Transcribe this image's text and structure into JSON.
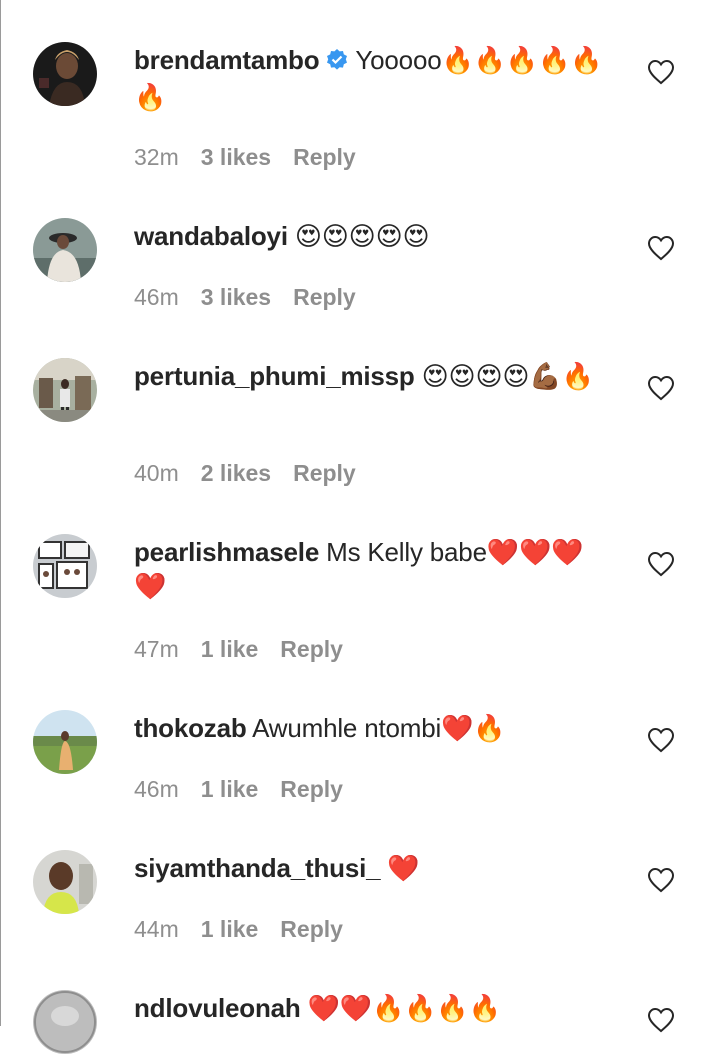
{
  "colors": {
    "text": "#262626",
    "meta": "#8e8e8e",
    "verified": "#3897f0"
  },
  "comments": [
    {
      "username": "brendamtambo",
      "verified": true,
      "text": "Yooooo🔥🔥🔥🔥🔥🔥",
      "time": "32m",
      "likes": "3 likes",
      "reply": "Reply"
    },
    {
      "username": "wandabaloyi",
      "verified": false,
      "text": "😍😍😍😍😍",
      "time": "46m",
      "likes": "3 likes",
      "reply": "Reply"
    },
    {
      "username": "pertunia_phumi_missp",
      "verified": false,
      "text": "😍😍😍😍💪🏾🔥",
      "time": "40m",
      "likes": "2 likes",
      "reply": "Reply"
    },
    {
      "username": "pearlishmasele",
      "verified": false,
      "text": "Ms Kelly babe❤️❤️❤️❤️",
      "time": "47m",
      "likes": "1 like",
      "reply": "Reply"
    },
    {
      "username": "thokozab",
      "verified": false,
      "text": "Awumhle ntombi❤️🔥",
      "time": "46m",
      "likes": "1 like",
      "reply": "Reply"
    },
    {
      "username": "siyamthanda_thusi_",
      "verified": false,
      "text": "❤️",
      "time": "44m",
      "likes": "1 like",
      "reply": "Reply"
    },
    {
      "username": "ndlovuleonah",
      "verified": false,
      "text": "❤️❤️🔥🔥🔥🔥",
      "time": "",
      "likes": "",
      "reply": ""
    }
  ]
}
